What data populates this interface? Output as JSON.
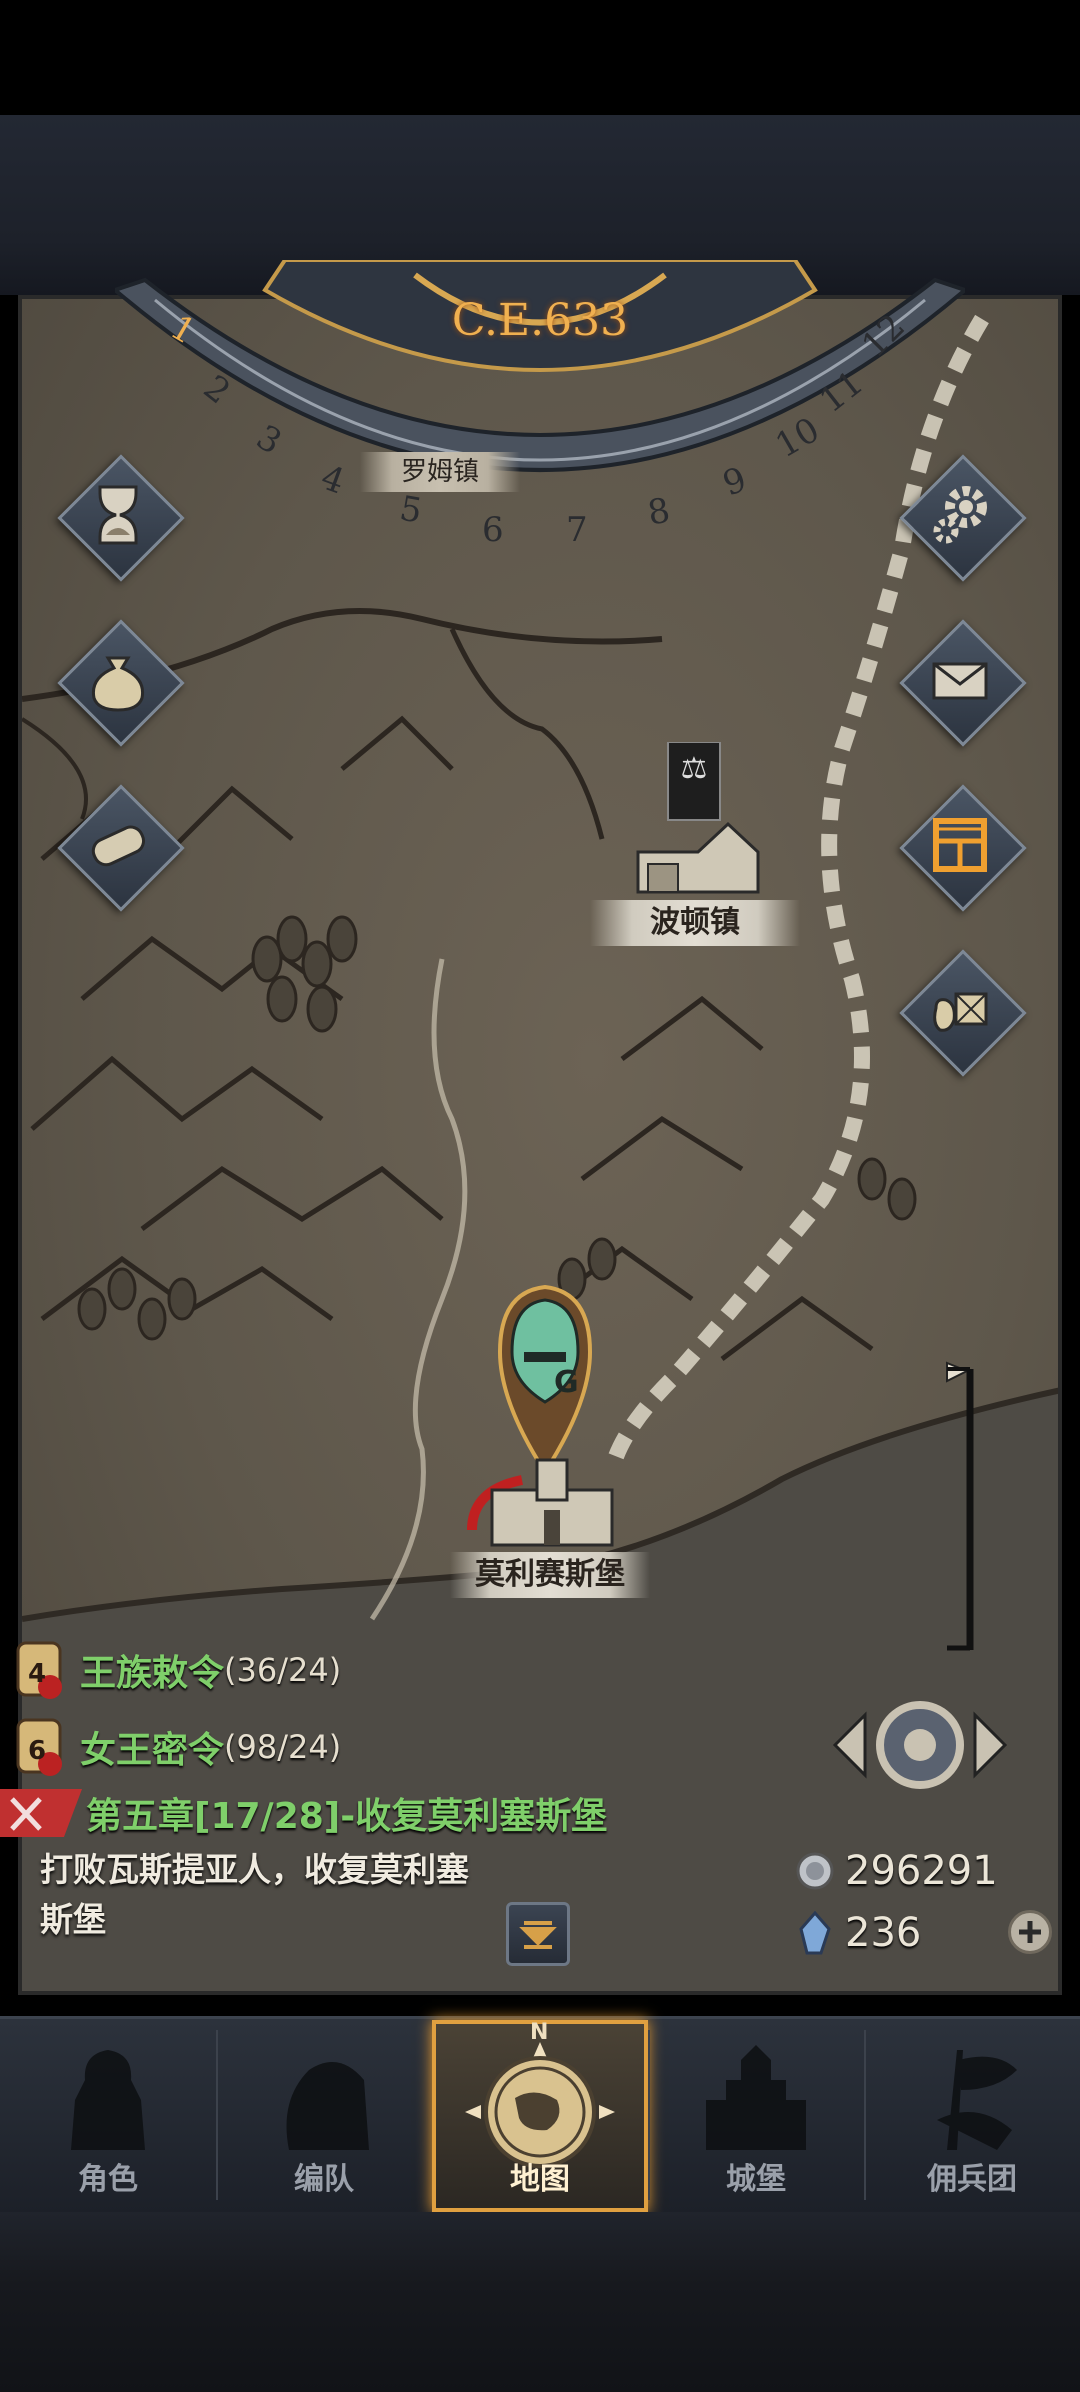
{
  "calendar": {
    "era_label": "C.E.633",
    "month_numbers": [
      "1",
      "2",
      "3",
      "4",
      "5",
      "6",
      "7",
      "8",
      "9",
      "10",
      "11",
      "12"
    ],
    "partial_town_label": "罗姆镇"
  },
  "side_buttons_left": [
    {
      "icon": "hourglass-icon"
    },
    {
      "icon": "money-bag-icon"
    },
    {
      "icon": "scroll-icon"
    }
  ],
  "side_buttons_right": [
    {
      "icon": "gear-icon"
    },
    {
      "icon": "mail-icon"
    },
    {
      "icon": "grid-window-icon"
    },
    {
      "icon": "supplies-icon"
    }
  ],
  "map": {
    "town_1": "波顿镇",
    "town_2": "莫利赛斯堡"
  },
  "quests": [
    {
      "badge": "4",
      "name": "王族敕令",
      "count": "(36/24)"
    },
    {
      "badge": "6",
      "name": "女王密令",
      "count": "(98/24)"
    }
  ],
  "chapter": {
    "title": "第五章[17/28]-收复莫利塞斯堡",
    "desc": "打败瓦斯提亚人，收复莫利塞斯堡"
  },
  "resources": {
    "silver": "296291",
    "crystal": "236"
  },
  "tabs": [
    {
      "label": "角色",
      "active": false
    },
    {
      "label": "编队",
      "active": false
    },
    {
      "label": "地图",
      "active": true,
      "compass_letter": "N"
    },
    {
      "label": "城堡",
      "active": false
    },
    {
      "label": "佣兵团",
      "active": false
    }
  ],
  "colors": {
    "accent_gold": "#e0a040",
    "quest_green": "#7fcf6a",
    "era_orange": "#f0b050"
  }
}
